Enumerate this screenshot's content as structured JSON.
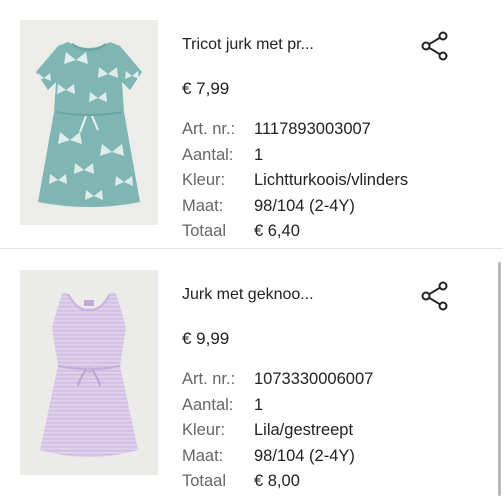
{
  "items": [
    {
      "name": "Tricot jurk met pr...",
      "price": "€ 7,99",
      "image": "dress-turquoise-butterfly",
      "details": {
        "article_label": "Art. nr.:",
        "article": "1117893003007",
        "qty_label": "Aantal:",
        "qty": "1",
        "color_label": "Kleur:",
        "color": "Lichtturkoois/vlinders",
        "size_label": "Maat:",
        "size": "98/104 (2-4Y)",
        "total_label": "Totaal",
        "total": "€ 6,40"
      },
      "share_icon": "share-icon"
    },
    {
      "name": "Jurk met geknoo...",
      "price": "€ 9,99",
      "image": "dress-lilac-striped",
      "details": {
        "article_label": "Art. nr.:",
        "article": "1073330006007",
        "qty_label": "Aantal:",
        "qty": "1",
        "color_label": "Kleur:",
        "color": "Lila/gestreept",
        "size_label": "Maat:",
        "size": "98/104 (2-4Y)",
        "total_label": "Totaal",
        "total": "€ 8,00"
      },
      "share_icon": "share-icon"
    }
  ],
  "colors": {
    "turquoise_dress": "#7fb6b4",
    "lilac_dress": "#ddd0ea",
    "label_gray": "#666666",
    "text": "#222222"
  }
}
